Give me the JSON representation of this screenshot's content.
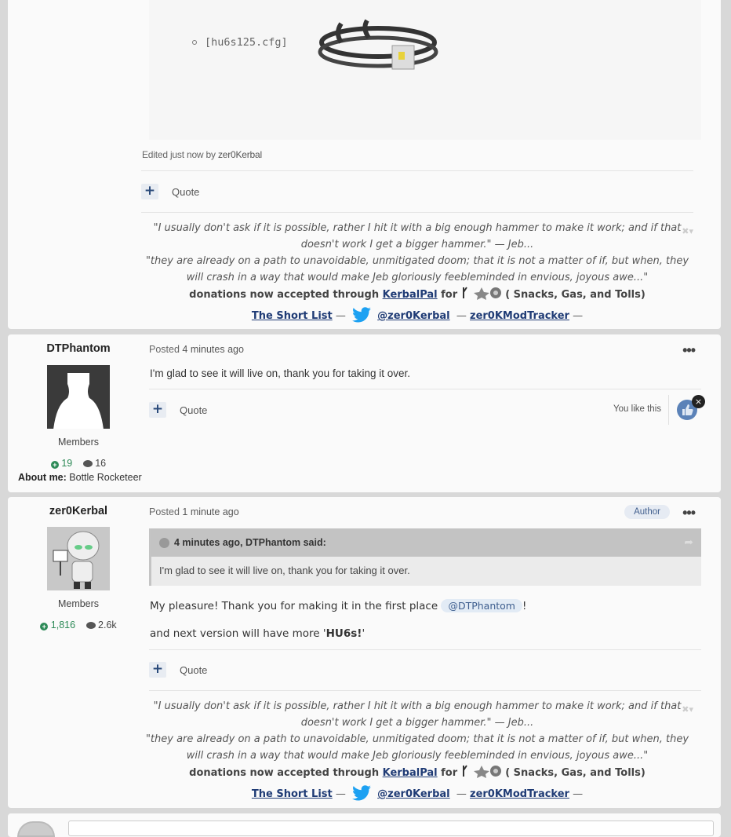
{
  "post1": {
    "bullet_text": "[hu6s125.cfg]",
    "edited_prefix": "Edited just now by",
    "edited_by": "zer0Kerbal",
    "quote_label": "Quote"
  },
  "signature": {
    "line1": "\"I usually don't ask if it is possible, rather I hit it with a big enough hammer to make it work; and if that",
    "line2": "doesn't work I get a bigger hammer.\"  — Jeb...",
    "line3": "\"they are already on a path to unavoidable, unmitigated doom; that it is not a matter of if, but when, they",
    "line4": "will crash in a way that would make Jeb gloriously feebleminded in envious, joyous awe...\"",
    "donations_prefix": "donations now accepted through",
    "kerbalpal": "KerbalPal",
    "for": "for",
    "snacks": "( Snacks, Gas, and Tolls)",
    "short_list": "The Short List",
    "dash": "—",
    "twitter": "@zer0Kerbal",
    "tracker": "zer0KModTracker"
  },
  "post2": {
    "author": "DTPhantom",
    "rank": "Members",
    "rep": "19",
    "posts": "16",
    "about_label": "About me:",
    "about_value": "Bottle Rocketeer",
    "posted_prefix": "Posted",
    "posted_time": "4 minutes ago",
    "text": "I'm glad to see it will live on, thank you for taking it over.",
    "quote_label": "Quote",
    "you_like": "You like this",
    "menu": "•••",
    "unlike_x": "×"
  },
  "post3": {
    "author": "zer0Kerbal",
    "rank": "Members",
    "rep": "1,816",
    "posts": "2.6k",
    "posted_prefix": "Posted",
    "posted_time": "1 minute ago",
    "author_badge": "Author",
    "menu": "•••",
    "cite_header": "4 minutes ago, DTPhantom said:",
    "cite_body": "I'm glad to see it will live on, thank you for taking it over.",
    "text1_prefix": "My pleasure! Thank you for making it in the first place",
    "mention": "@DTPhantom",
    "text1_suffix": "!",
    "text2_prefix": "and next version will have more '",
    "text2_bold": "HU6s!",
    "text2_suffix": "'",
    "quote_label": "Quote"
  },
  "icons": [
    "plus-icon",
    "twitter-bird-icon",
    "thumbs-up-icon",
    "close-icon",
    "reputation-icon",
    "comment-icon",
    "chevron-icon",
    "share-arrow-icon",
    "ellipsis-icon"
  ],
  "colors": {
    "link": "#1f3b75",
    "accent": "#2a4a7a",
    "rep_green": "#2d8a57",
    "twitter": "#1da1f2"
  }
}
